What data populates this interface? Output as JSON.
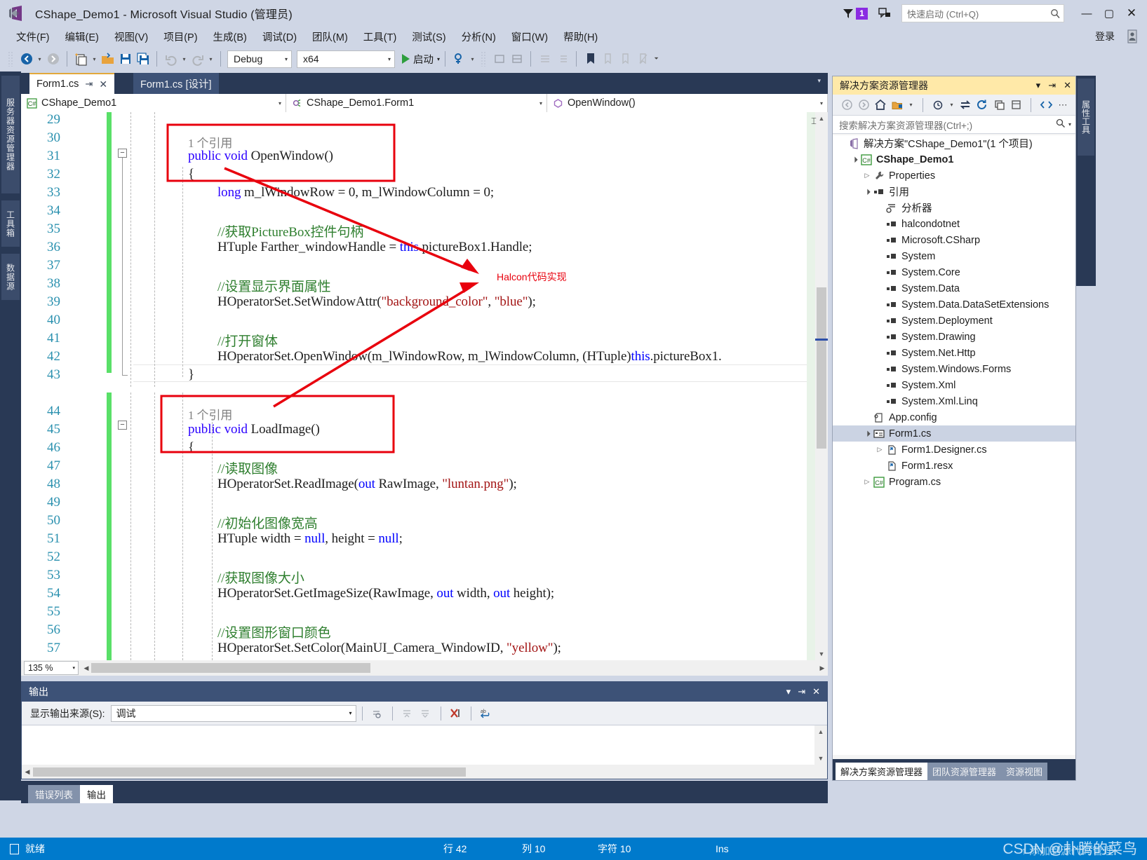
{
  "window": {
    "title": "CShape_Demo1 - Microsoft Visual Studio (管理员)",
    "logo_icon": "visual-studio-logo",
    "notification_count": "1",
    "quick_launch_placeholder": "快速启动 (Ctrl+Q)",
    "search_icon": "magnifier-icon",
    "minimize": "—",
    "maximize": "▢",
    "close": "✕",
    "signin_label": "登录"
  },
  "menu": {
    "items": [
      "文件(F)",
      "编辑(E)",
      "视图(V)",
      "项目(P)",
      "生成(B)",
      "调试(D)",
      "团队(M)",
      "工具(T)",
      "测试(S)",
      "分析(N)",
      "窗口(W)",
      "帮助(H)"
    ]
  },
  "toolbar": {
    "nav_back_icon": "back-arrow-icon",
    "nav_forward_icon": "forward-arrow-icon",
    "new_item_icon": "new-item-icon",
    "open_icon": "open-folder-icon",
    "save_icon": "save-icon",
    "save_all_icon": "save-all-icon",
    "undo_icon": "undo-icon",
    "redo_icon": "redo-icon",
    "config": "Debug",
    "platform": "x64",
    "start_label": "启动",
    "start_icon": "play-icon",
    "attach_icon": "attach-process-icon",
    "bookmark_icon": "bookmark-icon"
  },
  "left_dock": {
    "tabs": [
      "服务器资源管理器",
      "工具箱",
      "数据源"
    ]
  },
  "editor": {
    "tabs": [
      {
        "label": "Form1.cs",
        "active": true,
        "pin_icon": "pin-icon",
        "close_icon": "close-icon"
      },
      {
        "label": "Form1.cs [设计]",
        "active": false
      }
    ],
    "navbar": {
      "project": "CShape_Demo1",
      "project_icon": "csharp-file-icon",
      "type": "CShape_Demo1.Form1",
      "type_icon": "class-icon",
      "member": "OpenWindow()",
      "member_icon": "method-icon"
    },
    "zoom": "135 %",
    "lines": [
      {
        "n": 29,
        "text": ""
      },
      {
        "n": 30,
        "text": "public void OpenWindow()",
        "ref": "1 个引用",
        "fold": true
      },
      {
        "n": 31,
        "text": "{"
      },
      {
        "n": 32,
        "text": "long m_lWindowRow = 0, m_lWindowColumn = 0;"
      },
      {
        "n": 33,
        "text": ""
      },
      {
        "n": 34,
        "text": "//获取PictureBox控件句柄"
      },
      {
        "n": 35,
        "text": "HTuple Farther_windowHandle = this.pictureBox1.Handle;"
      },
      {
        "n": 36,
        "text": ""
      },
      {
        "n": 37,
        "text": "//设置显示界面属性"
      },
      {
        "n": 38,
        "text": "HOperatorSet.SetWindowAttr(\"background_color\", \"blue\");"
      },
      {
        "n": 39,
        "text": ""
      },
      {
        "n": 40,
        "text": "//打开窗体"
      },
      {
        "n": 41,
        "text": "HOperatorSet.OpenWindow(m_lWindowRow, m_lWindowColumn, (HTuple)this.pictureBox1."
      },
      {
        "n": 42,
        "text": "}"
      },
      {
        "n": 43,
        "text": ""
      },
      {
        "n": 44,
        "text": "public void LoadImage()",
        "ref": "1 个引用",
        "fold": true
      },
      {
        "n": 45,
        "text": "{"
      },
      {
        "n": 46,
        "text": "//读取图像"
      },
      {
        "n": 47,
        "text": "HOperatorSet.ReadImage(out RawImage, \"luntan.png\");"
      },
      {
        "n": 48,
        "text": ""
      },
      {
        "n": 49,
        "text": "//初始化图像宽高"
      },
      {
        "n": 50,
        "text": "HTuple width = null, height = null;"
      },
      {
        "n": 51,
        "text": ""
      },
      {
        "n": 52,
        "text": "//获取图像大小"
      },
      {
        "n": 53,
        "text": "HOperatorSet.GetImageSize(RawImage, out width, out height);"
      },
      {
        "n": 54,
        "text": ""
      },
      {
        "n": 55,
        "text": "//设置图形窗口颜色"
      },
      {
        "n": 56,
        "text": "HOperatorSet.SetColor(MainUI_Camera_WindowID, \"yellow\");"
      },
      {
        "n": 57,
        "text": ""
      }
    ],
    "annotation": {
      "label": "Halcon代码实现",
      "color": "#e8000d"
    }
  },
  "output": {
    "title": "输出",
    "dropdown_icon": "chevron-down-icon",
    "pin_icon": "pin-icon",
    "close_icon": "close-icon",
    "source_label": "显示输出来源(S):",
    "source_value": "调试",
    "btn_find_icon": "find-message-icon",
    "btn_up_icon": "go-up-icon",
    "btn_down_icon": "go-down-icon",
    "btn_clear_icon": "clear-all-icon",
    "btn_wrap_icon": "word-wrap-icon",
    "body_text": ""
  },
  "bottom_tabs": [
    {
      "label": "错误列表",
      "selected": false
    },
    {
      "label": "输出",
      "selected": true
    }
  ],
  "solution_explorer": {
    "title": "解决方案资源管理器",
    "title_buttons": [
      "chevron-down-icon",
      "pin-icon",
      "close-icon"
    ],
    "toolbar_icons": [
      "back-icon",
      "forward-icon",
      "home-icon",
      "show-all-files-icon",
      "pending-changes-icon",
      "sync-icon",
      "refresh-icon",
      "collapse-all-icon",
      "properties-icon",
      "view-code-icon",
      "overflow-icon"
    ],
    "search_placeholder": "搜索解决方案资源管理器(Ctrl+;)",
    "search_icon": "magnifier-icon",
    "tree": [
      {
        "label": "解决方案\"CShape_Demo1\"(1 个项目)",
        "indent": 0,
        "twist": "",
        "icon": "solution-icon",
        "bold": false
      },
      {
        "label": "CShape_Demo1",
        "indent": 1,
        "twist": "▲",
        "icon": "csharp-project-icon",
        "bold": true
      },
      {
        "label": "Properties",
        "indent": 2,
        "twist": "▷",
        "icon": "properties-wrench-icon",
        "bold": false
      },
      {
        "label": "引用",
        "indent": 2,
        "twist": "▲",
        "icon": "references-icon",
        "bold": false
      },
      {
        "label": "分析器",
        "indent": 3,
        "twist": "",
        "icon": "analyzer-icon",
        "bold": false
      },
      {
        "label": "halcondotnet",
        "indent": 3,
        "twist": "",
        "icon": "reference-icon",
        "bold": false
      },
      {
        "label": "Microsoft.CSharp",
        "indent": 3,
        "twist": "",
        "icon": "reference-icon",
        "bold": false
      },
      {
        "label": "System",
        "indent": 3,
        "twist": "",
        "icon": "reference-icon",
        "bold": false
      },
      {
        "label": "System.Core",
        "indent": 3,
        "twist": "",
        "icon": "reference-icon",
        "bold": false
      },
      {
        "label": "System.Data",
        "indent": 3,
        "twist": "",
        "icon": "reference-icon",
        "bold": false
      },
      {
        "label": "System.Data.DataSetExtensions",
        "indent": 3,
        "twist": "",
        "icon": "reference-icon",
        "bold": false
      },
      {
        "label": "System.Deployment",
        "indent": 3,
        "twist": "",
        "icon": "reference-icon",
        "bold": false
      },
      {
        "label": "System.Drawing",
        "indent": 3,
        "twist": "",
        "icon": "reference-icon",
        "bold": false
      },
      {
        "label": "System.Net.Http",
        "indent": 3,
        "twist": "",
        "icon": "reference-icon",
        "bold": false
      },
      {
        "label": "System.Windows.Forms",
        "indent": 3,
        "twist": "",
        "icon": "reference-icon",
        "bold": false
      },
      {
        "label": "System.Xml",
        "indent": 3,
        "twist": "",
        "icon": "reference-icon",
        "bold": false
      },
      {
        "label": "System.Xml.Linq",
        "indent": 3,
        "twist": "",
        "icon": "reference-icon",
        "bold": false
      },
      {
        "label": "App.config",
        "indent": 2,
        "twist": "",
        "icon": "config-file-icon",
        "bold": false
      },
      {
        "label": "Form1.cs",
        "indent": 2,
        "twist": "▲",
        "icon": "form-icon",
        "bold": false,
        "selected": true
      },
      {
        "label": "Form1.Designer.cs",
        "indent": 3,
        "twist": "▷",
        "icon": "cs-file-icon",
        "bold": false
      },
      {
        "label": "Form1.resx",
        "indent": 3,
        "twist": "",
        "icon": "resx-file-icon",
        "bold": false
      },
      {
        "label": "Program.cs",
        "indent": 2,
        "twist": "▷",
        "icon": "csharp-file-icon",
        "bold": false
      }
    ],
    "tabs": [
      {
        "label": "解决方案资源管理器",
        "selected": true
      },
      {
        "label": "团队资源管理器",
        "selected": false
      },
      {
        "label": "资源视图",
        "selected": false
      }
    ]
  },
  "right_dock": {
    "tabs": [
      "属性工具"
    ]
  },
  "statusbar": {
    "ready": "就绪",
    "ready_icon": "ready-icon",
    "line": "行 42",
    "column": "列 10",
    "character": "字符 10",
    "insert_mode": "Ins",
    "watermark": "CSDN @扑腾的菜鸟",
    "watermark_sub": "添加到源代码管理",
    "accent_color": "#007acc"
  }
}
